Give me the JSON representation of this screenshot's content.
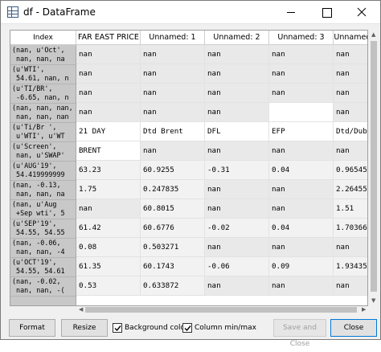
{
  "window": {
    "title": "df - DataFrame"
  },
  "grid": {
    "index_header": "Index",
    "columns": [
      "FAR EAST PRICE S",
      "Unnamed: 1",
      "Unnamed: 2",
      "Unnamed: 3",
      "Unnamed: 4"
    ],
    "index": [
      "(nan, u'Oct',\n nan, nan, na",
      "(u'WTI',\n 54.61, nan, n",
      "(u'TI/BR',\n -6.65, nan, n",
      "(nan, nan, nan,\n nan, nan, nan",
      "(u'Ti/Br ',\n u'WTI', u'WT",
      "(u'Screen',\n nan, u'SWAP'",
      "(u'AUG'19',\n 54.419999999",
      "(nan, -0.13,\n nan, nan, na",
      "(nan, u'Aug\n +Sep wti', 5",
      "(u'SEP'19',\n 54.55, 54.55",
      "(nan, -0.06,\n nan, nan, -4",
      "(u'OCT'19',\n 54.55, 54.61",
      "(nan, -0.02,\n nan, nan, -("
    ],
    "rows": [
      [
        "nan",
        "nan",
        "nan",
        "nan",
        "nan"
      ],
      [
        "nan",
        "nan",
        "nan",
        "nan",
        "nan"
      ],
      [
        "nan",
        "nan",
        "nan",
        "nan",
        "nan"
      ],
      [
        "nan",
        "nan",
        "nan",
        "",
        "nan"
      ],
      [
        "21 DAY",
        "Dtd Brent",
        "DFL",
        "EFP",
        "Dtd/Dub"
      ],
      [
        "BRENT",
        "nan",
        "nan",
        "nan",
        "nan"
      ],
      [
        "63.23",
        "60.9255",
        "-0.31",
        "0.04",
        "0.965455"
      ],
      [
        "1.75",
        "0.247835",
        "nan",
        "nan",
        "2.26455"
      ],
      [
        "nan",
        "60.8015",
        "nan",
        "nan",
        "1.51"
      ],
      [
        "61.42",
        "60.6776",
        "-0.02",
        "0.04",
        "1.70366"
      ],
      [
        "0.08",
        "0.503271",
        "nan",
        "nan",
        "nan"
      ],
      [
        "61.35",
        "60.1743",
        "-0.06",
        "0.09",
        "1.93435"
      ],
      [
        "0.53",
        "0.633872",
        "nan",
        "nan",
        "nan"
      ]
    ],
    "cell_colors": [
      [
        "#e9e9e9",
        "#e9e9e9",
        "#e9e9e9",
        "#e9e9e9",
        "#e9e9e9"
      ],
      [
        "#e9e9e9",
        "#e9e9e9",
        "#e9e9e9",
        "#e9e9e9",
        "#e9e9e9"
      ],
      [
        "#e9e9e9",
        "#e9e9e9",
        "#e9e9e9",
        "#e9e9e9",
        "#e9e9e9"
      ],
      [
        "#e9e9e9",
        "#e9e9e9",
        "#e9e9e9",
        "#ffffff",
        "#e9e9e9"
      ],
      [
        "#ffffff",
        "#ffffff",
        "#ffffff",
        "#ffffff",
        "#ffffff"
      ],
      [
        "#ffffff",
        "#e9e9e9",
        "#e9e9e9",
        "#e9e9e9",
        "#e9e9e9"
      ],
      [
        "#f2f2f2",
        "#f2f2f2",
        "#f2f2f2",
        "#f2f2f2",
        "#f2f2f2"
      ],
      [
        "#f2f2f2",
        "#f2f2f2",
        "#e9e9e9",
        "#e9e9e9",
        "#f2f2f2"
      ],
      [
        "#e9e9e9",
        "#f2f2f2",
        "#e9e9e9",
        "#e9e9e9",
        "#f2f2f2"
      ],
      [
        "#f2f2f2",
        "#f2f2f2",
        "#f2f2f2",
        "#f2f2f2",
        "#f2f2f2"
      ],
      [
        "#f2f2f2",
        "#f2f2f2",
        "#e9e9e9",
        "#e9e9e9",
        "#e9e9e9"
      ],
      [
        "#f2f2f2",
        "#f2f2f2",
        "#f2f2f2",
        "#f2f2f2",
        "#f2f2f2"
      ],
      [
        "#f2f2f2",
        "#f2f2f2",
        "#e9e9e9",
        "#e9e9e9",
        "#e9e9e9"
      ]
    ]
  },
  "footer": {
    "format_label": "Format",
    "resize_label": "Resize",
    "background_color_label": "Background color",
    "background_color_checked": true,
    "column_minmax_label": "Column min/max",
    "column_minmax_checked": true,
    "save_close_label": "Save and Close",
    "close_label": "Close"
  },
  "colors": {
    "index_background": "#c8c8c8",
    "primary_border": "#0078d7"
  }
}
